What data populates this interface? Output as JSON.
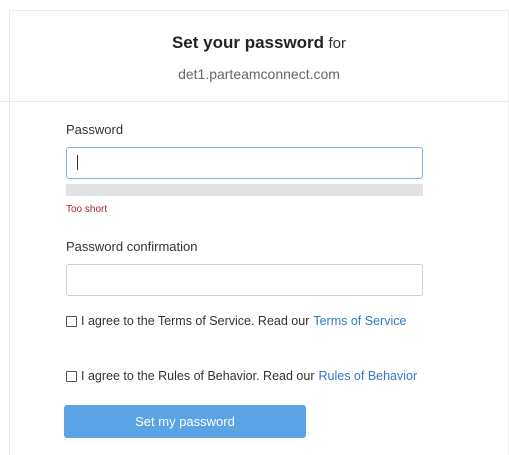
{
  "header": {
    "title_bold": "Set your password",
    "title_suffix": "for",
    "domain": "det1.parteamconnect.com"
  },
  "form": {
    "password_label": "Password",
    "password_value": "",
    "password_strength": {
      "level": 0,
      "message": "Too short",
      "fill_color": "#d9534f",
      "message_color": "#b0242a"
    },
    "confirmation_label": "Password confirmation",
    "confirmation_value": "",
    "terms": {
      "checked": false,
      "text": "I agree to the Terms of Service. Read our",
      "link_text": "Terms of Service"
    },
    "behavior": {
      "checked": false,
      "text": "I agree to the Rules of Behavior. Read our",
      "link_text": "Rules of Behavior"
    },
    "submit_label": "Set my password"
  },
  "colors": {
    "accent": "#5aa3e5",
    "link": "#2f7ac5",
    "focus_border": "#7fb2e5"
  }
}
